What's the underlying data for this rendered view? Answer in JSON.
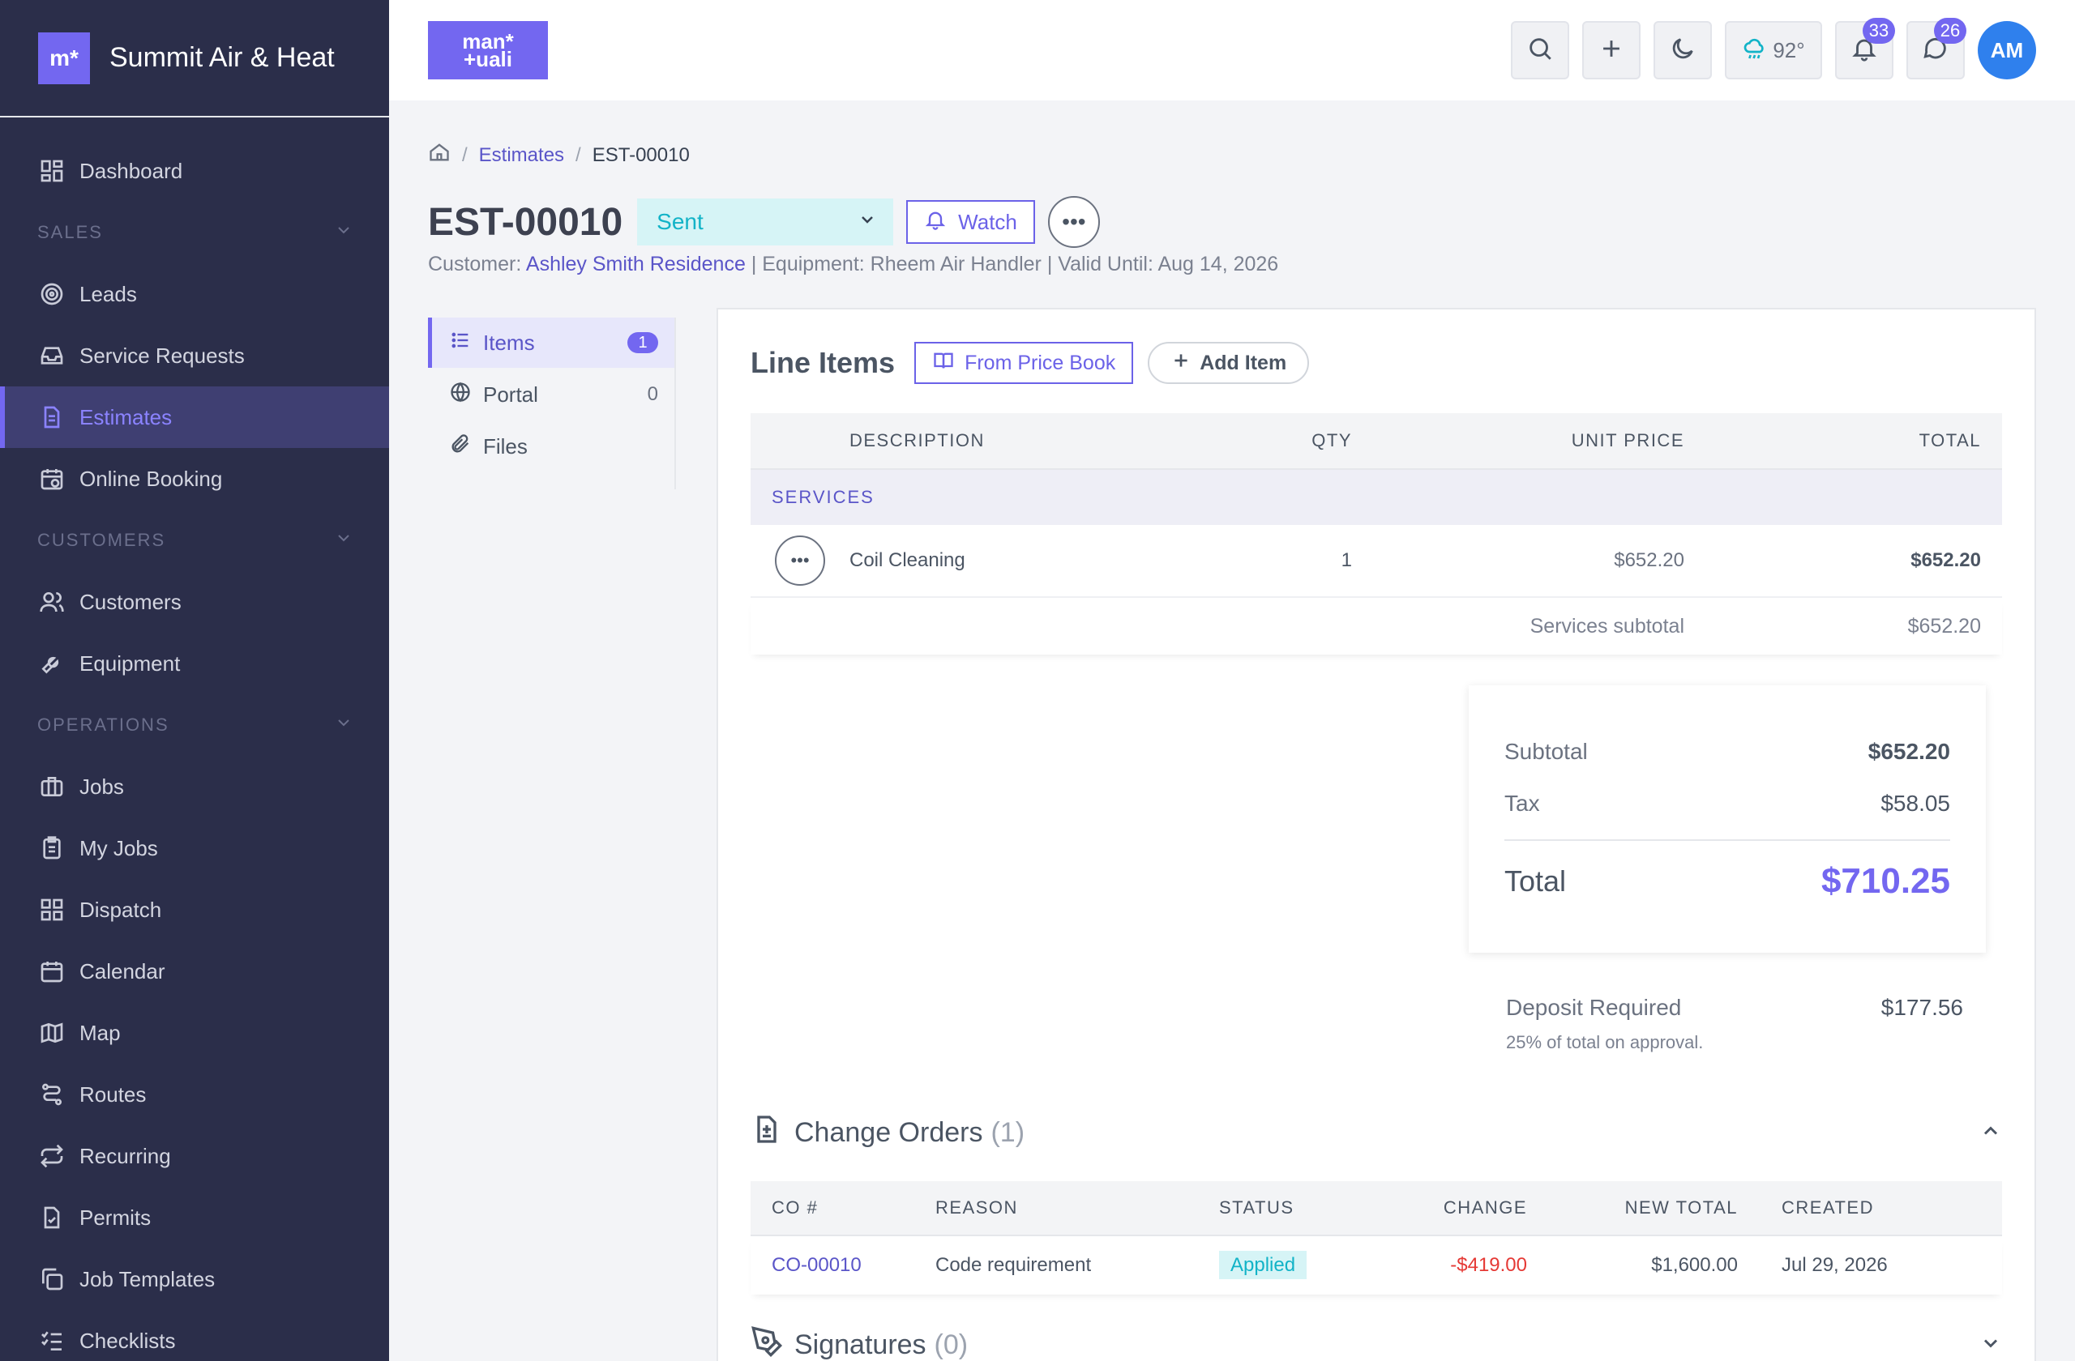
{
  "brand": {
    "logo": "m*",
    "name": "Summit Air & Heat"
  },
  "nav": {
    "dashboard": "Dashboard",
    "sales_label": "SALES",
    "leads": "Leads",
    "service_requests": "Service Requests",
    "estimates": "Estimates",
    "online_booking": "Online Booking",
    "customers_label": "CUSTOMERS",
    "customers": "Customers",
    "equipment": "Equipment",
    "operations_label": "OPERATIONS",
    "jobs": "Jobs",
    "my_jobs": "My Jobs",
    "dispatch": "Dispatch",
    "calendar": "Calendar",
    "map": "Map",
    "routes": "Routes",
    "recurring": "Recurring",
    "permits": "Permits",
    "job_templates": "Job Templates",
    "checklists": "Checklists"
  },
  "topbar": {
    "logo_line1": "man*",
    "logo_line2": "+uali",
    "weather": "92°",
    "notifications_count": "33",
    "messages_count": "26",
    "avatar_initials": "AM"
  },
  "breadcrumb": {
    "estimates": "Estimates",
    "current": "EST-00010"
  },
  "estimate": {
    "number": "EST-00010",
    "status": "Sent",
    "watch_label": "Watch",
    "more": "•••",
    "customer_label": "Customer:",
    "customer_name": "Ashley Smith Residence",
    "rest": "| Equipment: Rheem Air Handler | Valid Until: Aug 14, 2026"
  },
  "tabs": [
    {
      "label": "Items",
      "count": "1"
    },
    {
      "label": "Portal",
      "count": "0"
    },
    {
      "label": "Files",
      "count": ""
    }
  ],
  "line_items": {
    "title": "Line Items",
    "from_price_book": "From Price Book",
    "add_item": "Add Item",
    "headers": {
      "description": "DESCRIPTION",
      "qty": "QTY",
      "unit_price": "UNIT PRICE",
      "total": "TOTAL"
    },
    "section": "SERVICES",
    "rows": [
      {
        "description": "Coil Cleaning",
        "qty": "1",
        "unit_price": "$652.20",
        "total": "$652.20"
      }
    ],
    "subtotal_label": "Services subtotal",
    "subtotal_value": "$652.20"
  },
  "totals": {
    "subtotal_label": "Subtotal",
    "subtotal": "$652.20",
    "tax_label": "Tax",
    "tax": "$58.05",
    "total_label": "Total",
    "total": "$710.25"
  },
  "deposit": {
    "label": "Deposit Required",
    "value": "$177.56",
    "note": "25% of total on approval."
  },
  "change_orders": {
    "title": "Change Orders",
    "count": "(1)",
    "headers": {
      "co": "CO #",
      "reason": "REASON",
      "status": "STATUS",
      "change": "CHANGE",
      "new_total": "NEW TOTAL",
      "created": "CREATED"
    },
    "rows": [
      {
        "co": "CO-00010",
        "reason": "Code requirement",
        "status": "Applied",
        "change": "-$419.00",
        "new_total": "$1,600.00",
        "created": "Jul 29, 2026"
      }
    ]
  },
  "signatures": {
    "title": "Signatures",
    "count": "(0)"
  },
  "colors": {
    "accent": "#7367f0",
    "sidebar": "#2b2e4a",
    "status_bg": "#d6f4f6",
    "status_text": "#12b3c7",
    "negative": "#e53935"
  }
}
